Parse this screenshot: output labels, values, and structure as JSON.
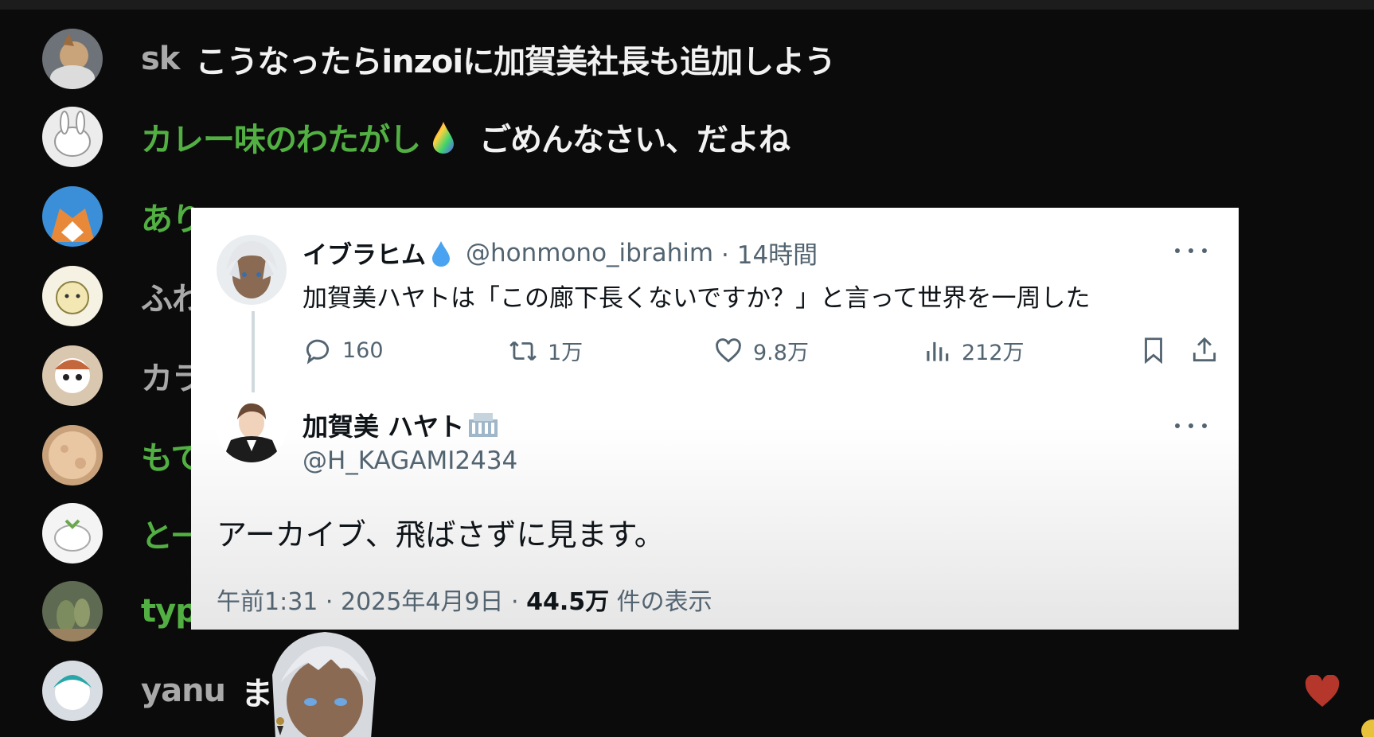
{
  "chat": {
    "messages": [
      {
        "name": "sk",
        "text": "こうなったらinzoiに加賀美社長も追加しよう"
      },
      {
        "name": "カレー味のわたがし",
        "text": "ごめんなさい、だよね"
      },
      {
        "name": "あり",
        "text": ""
      },
      {
        "name": "ふわ",
        "text": ""
      },
      {
        "name": "カラ",
        "text": ""
      },
      {
        "name": "もて",
        "text": ""
      },
      {
        "name": "と一",
        "text": ""
      },
      {
        "name": "typ",
        "text": ""
      },
      {
        "name": "yanu",
        "text": "ま"
      }
    ],
    "colors": {
      "owner_name": "#a9a9a9",
      "member_name": "#52b043",
      "message": "#f2f2f2"
    }
  },
  "tweet": {
    "author": {
      "name": "イブラヒム",
      "handle": "@honmono_ibrahim",
      "time": "· 14時間"
    },
    "text": "加賀美ハヤトは「この廊下長くないですか？」と言って世界を一周した",
    "stats": {
      "replies": "160",
      "reposts": "1万",
      "likes": "9.8万",
      "views": "212万"
    }
  },
  "reply": {
    "author": {
      "name": "加賀美 ハヤト",
      "handle": "@H_KAGAMI2434"
    },
    "text": "アーカイブ、飛ばさずに見ます。",
    "meta_prefix": "午前1:31 · 2025年4月9日 · ",
    "views": "44.5万",
    "views_suffix": " 件の表示"
  }
}
